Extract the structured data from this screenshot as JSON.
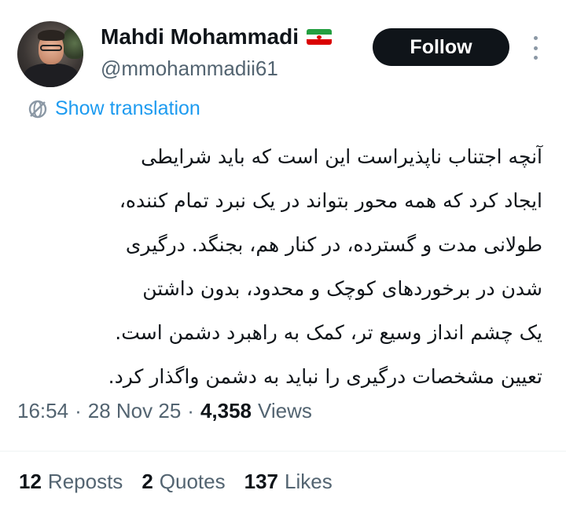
{
  "author": {
    "name": "Mahdi Mohammadi",
    "flag": "Iran flag",
    "handle": "@mmohammadii61",
    "avatar_desc": "profile photo"
  },
  "follow_button": {
    "label": "Follow"
  },
  "more_icon": "more-vertical-icon",
  "translation": {
    "label": "Show translation",
    "icon": "translate-globe-icon"
  },
  "tweet": {
    "lines": [
      "آنچه اجتناب ناپذیراست این است که باید شرایطی",
      "ایجاد کرد که همه محور بتواند در یک نبرد تمام کننده،",
      "طولانی مدت و گسترده، در کنار هم، بجنگد. درگیری",
      "شدن در برخوردهای کوچک و محدود، بدون داشتن",
      "یک چشم انداز وسیع تر، کمک به راهبرد دشمن است.",
      "تعیین مشخصات درگیری را نباید به دشمن واگذار کرد."
    ]
  },
  "meta": {
    "time": "16:54",
    "separator": "·",
    "date": "28 Nov 25",
    "views_count": "4,358",
    "views_label": "Views"
  },
  "stats": {
    "reposts": {
      "count": "12",
      "label": "Reposts"
    },
    "quotes": {
      "count": "2",
      "label": "Quotes"
    },
    "likes": {
      "count": "137",
      "label": "Likes"
    }
  },
  "colors": {
    "text": "#0f1419",
    "secondary": "#536471",
    "link": "#1d9bf0",
    "button_bg": "#0f1419",
    "button_text": "#ffffff"
  }
}
